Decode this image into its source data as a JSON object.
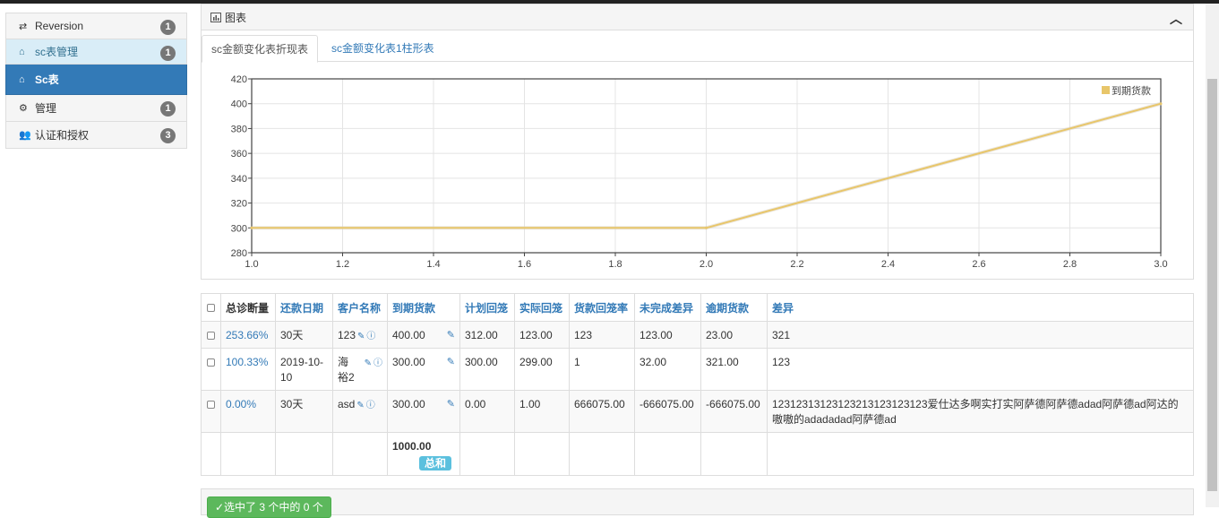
{
  "sidebar": {
    "items": [
      {
        "icon": "⇄",
        "label": "Reversion",
        "badge": "1"
      },
      {
        "icon": "⌂",
        "label": "sc表管理",
        "badge": "1"
      },
      {
        "icon": "⌂",
        "label": "Sc表",
        "badge": ""
      },
      {
        "icon": "⚙",
        "label": "管理",
        "badge": "1"
      },
      {
        "icon": "👥",
        "label": "认证和授权",
        "badge": "3"
      }
    ]
  },
  "panel": {
    "title": "图表",
    "tabs": [
      "sc金额变化表折现表",
      "sc金额变化表1柱形表"
    ]
  },
  "chart_data": {
    "type": "line",
    "x": [
      1.0,
      2.0,
      3.0
    ],
    "series": [
      {
        "name": "到期货款",
        "values": [
          300,
          300,
          400
        ],
        "color": "#e8c66a"
      }
    ],
    "xlim": [
      1.0,
      3.0
    ],
    "ylim": [
      280,
      420
    ],
    "xticks": [
      "1.0",
      "1.2",
      "1.4",
      "1.6",
      "1.8",
      "2.0",
      "2.2",
      "2.4",
      "2.6",
      "2.8",
      "3.0"
    ],
    "yticks": [
      "280",
      "300",
      "320",
      "340",
      "360",
      "380",
      "400",
      "420"
    ],
    "grid": true,
    "legend": "top-right"
  },
  "table": {
    "headers": [
      "总诊断量",
      "还款日期",
      "客户名称",
      "到期货款",
      "计划回笼",
      "实际回笼",
      "货款回笼率",
      "未完成差异",
      "逾期货款",
      "差异"
    ],
    "rows": [
      {
        "ratio": "253.66%",
        "date": "30天",
        "customer": "123",
        "due": "400.00",
        "plan": "312.00",
        "actual": "123.00",
        "rate": "123",
        "unfinished": "123.00",
        "overdue": "23.00",
        "diff": "321"
      },
      {
        "ratio": "100.33%",
        "date": "2019-10-10",
        "customer": "海裕2",
        "due": "300.00",
        "plan": "300.00",
        "actual": "299.00",
        "rate": "1",
        "unfinished": "32.00",
        "overdue": "321.00",
        "diff": "123"
      },
      {
        "ratio": "0.00%",
        "date": "30天",
        "customer": "asd",
        "due": "300.00",
        "plan": "0.00",
        "actual": "1.00",
        "rate": "666075.00",
        "unfinished": "-666075.00",
        "overdue": "-666075.00",
        "diff": "12312313123123213123123123爱仕达多啊实打实阿萨德阿萨德adad阿萨德ad阿达的嗷嗷的adadadad阿萨德ad"
      }
    ],
    "total": "1000.00",
    "total_label": "总和"
  },
  "footer": {
    "action_label": "✓选中了 3 个中的 0 个"
  }
}
